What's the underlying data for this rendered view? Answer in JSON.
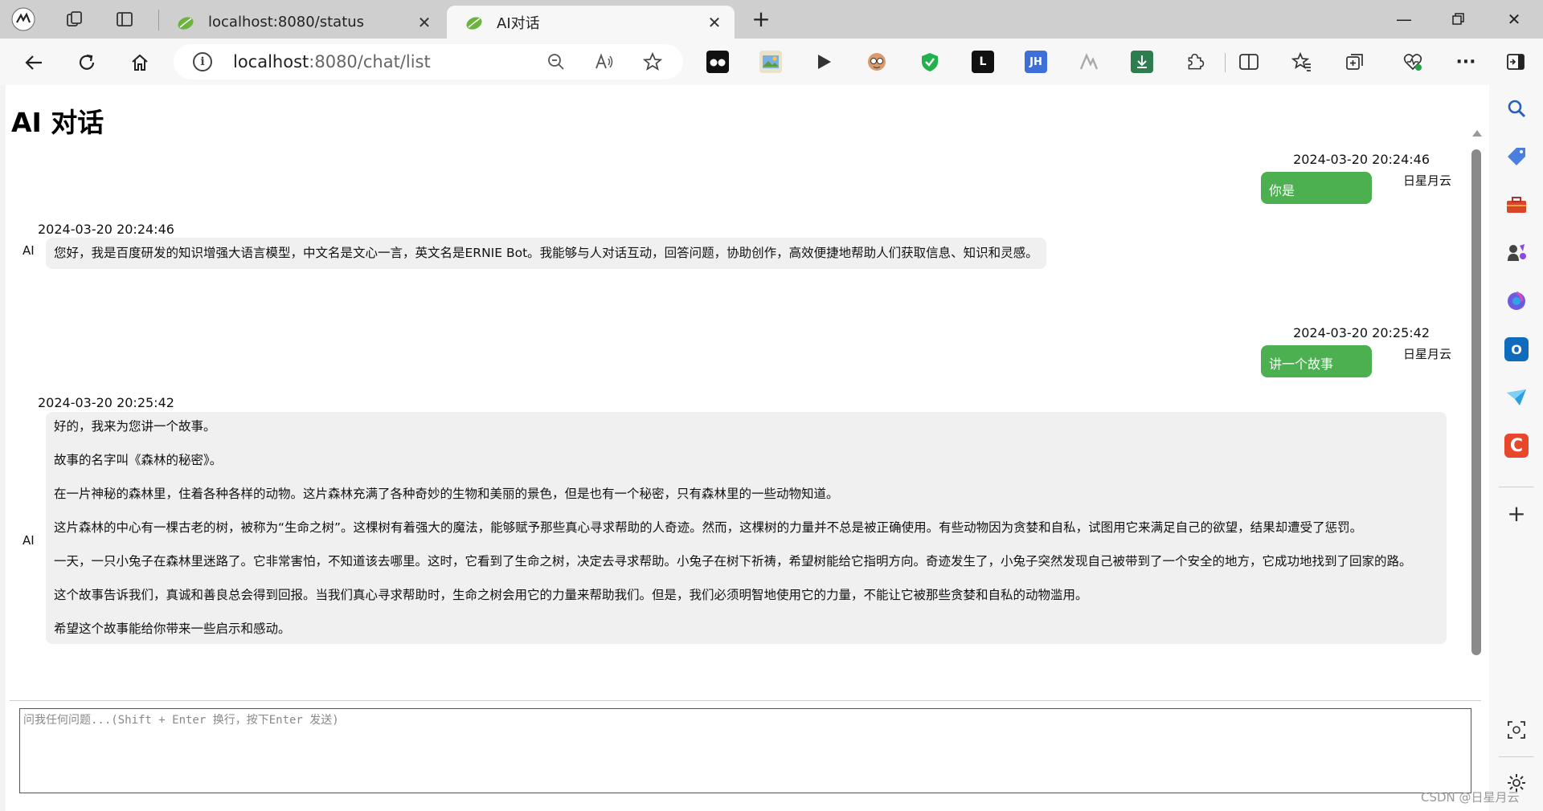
{
  "browser": {
    "tabs": [
      {
        "title": "localhost:8080/status",
        "active": false
      },
      {
        "title": "AI对话",
        "active": true
      }
    ],
    "url_host": "localhost",
    "url_path": ":8080/chat/list"
  },
  "page": {
    "title": "AI 对话",
    "messages": [
      {
        "role": "user",
        "author": "日星月云",
        "time": "2024-03-20 20:24:46",
        "text": "你是"
      },
      {
        "role": "ai",
        "author": "AI",
        "time": "2024-03-20 20:24:46",
        "paragraphs": [
          "您好，我是百度研发的知识增强大语言模型，中文名是文心一言，英文名是ERNIE Bot。我能够与人对话互动，回答问题，协助创作，高效便捷地帮助人们获取信息、知识和灵感。"
        ]
      },
      {
        "role": "user",
        "author": "日星月云",
        "time": "2024-03-20 20:25:42",
        "text": "讲一个故事"
      },
      {
        "role": "ai",
        "author": "AI",
        "time": "2024-03-20 20:25:42",
        "paragraphs": [
          "好的，我来为您讲一个故事。",
          "故事的名字叫《森林的秘密》。",
          "在一片神秘的森林里，住着各种各样的动物。这片森林充满了各种奇妙的生物和美丽的景色，但是也有一个秘密，只有森林里的一些动物知道。",
          "这片森林的中心有一棵古老的树，被称为“生命之树”。这棵树有着强大的魔法，能够赋予那些真心寻求帮助的人奇迹。然而，这棵树的力量并不总是被正确使用。有些动物因为贪婪和自私，试图用它来满足自己的欲望，结果却遭受了惩罚。",
          "一天，一只小兔子在森林里迷路了。它非常害怕，不知道该去哪里。这时，它看到了生命之树，决定去寻求帮助。小兔子在树下祈祷，希望树能给它指明方向。奇迹发生了，小兔子突然发现自己被带到了一个安全的地方，它成功地找到了回家的路。",
          "这个故事告诉我们，真诚和善良总会得到回报。当我们真心寻求帮助时，生命之树会用它的力量来帮助我们。但是，我们必须明智地使用它的力量，不能让它被那些贪婪和自私的动物滥用。",
          "希望这个故事能给你带来一些启示和感动。"
        ]
      }
    ],
    "input_placeholder": "问我任何问题...(Shift + Enter 换行，按下Enter 发送)"
  },
  "extensions": {
    "lastpass": "L",
    "jh": "JH"
  },
  "watermark": "CSDN @日星月云",
  "colors": {
    "user_bubble": "#4caf50",
    "ai_bubble": "#f0f0f0"
  }
}
